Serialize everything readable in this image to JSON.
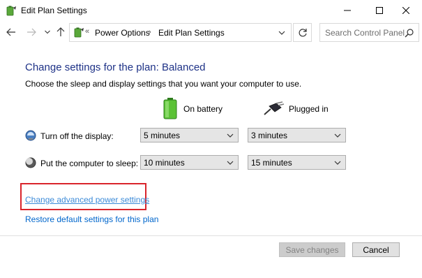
{
  "window": {
    "title": "Edit Plan Settings",
    "icon": "power-plan-icon"
  },
  "address_bar": {
    "separator": "«",
    "breadcrumbs": [
      "Power Options",
      "Edit Plan Settings"
    ],
    "crumb_arrow": "›"
  },
  "search": {
    "placeholder": "Search Control Panel"
  },
  "main": {
    "heading": "Change settings for the plan: Balanced",
    "subtext": "Choose the sleep and display settings that you want your computer to use.",
    "columns": {
      "battery": "On battery",
      "plugged": "Plugged in"
    },
    "rows": [
      {
        "label": "Turn off the display:",
        "icon": "display-icon",
        "battery_value": "5 minutes",
        "plugged_value": "3 minutes"
      },
      {
        "label": "Put the computer to sleep:",
        "icon": "sleep-moon-icon",
        "battery_value": "10 minutes",
        "plugged_value": "15 minutes"
      }
    ],
    "links": {
      "advanced": "Change advanced power settings",
      "restore": "Restore default settings for this plan"
    }
  },
  "footer": {
    "save_label": "Save changes",
    "cancel_label": "Cancel"
  },
  "colors": {
    "heading": "#1e3287",
    "link": "#0066cc",
    "highlight": "#d9242b"
  }
}
